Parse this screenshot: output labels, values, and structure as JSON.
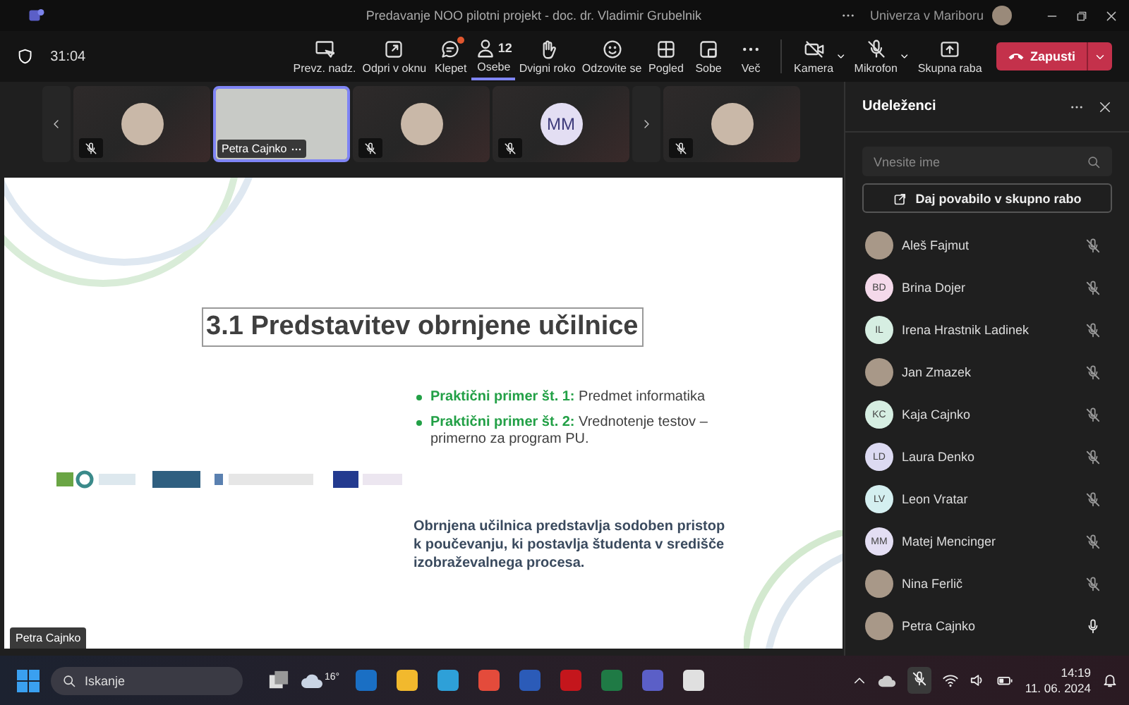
{
  "window": {
    "title": "Predavanje NOO pilotni projekt - doc. dr. Vladimir Grubelnik",
    "account": "Univerza v Mariboru"
  },
  "meeting": {
    "timer": "31:04"
  },
  "toolbar": {
    "items": [
      {
        "label": "Prevz. nadz.",
        "selected": false,
        "unread": false
      },
      {
        "label": "Odpri v oknu",
        "selected": false,
        "unread": false
      },
      {
        "label": "Klepet",
        "selected": false,
        "unread": true
      },
      {
        "label": "Osebe",
        "count": "12",
        "selected": true,
        "unread": false
      },
      {
        "label": "Dvigni roko",
        "selected": false,
        "unread": false
      },
      {
        "label": "Odzovite se",
        "selected": false,
        "unread": false
      },
      {
        "label": "Pogled",
        "selected": false,
        "unread": false
      },
      {
        "label": "Sobe",
        "selected": false,
        "unread": false
      },
      {
        "label": "Več",
        "selected": false,
        "unread": false
      }
    ],
    "devices": [
      {
        "kind": "camera",
        "label": "Kamera",
        "off": true
      },
      {
        "kind": "microphone",
        "label": "Mikrofon",
        "off": true
      },
      {
        "kind": "share",
        "label": "Skupna raba",
        "off": false
      }
    ],
    "leave": {
      "label": "Zapusti"
    }
  },
  "video_strip": [
    {
      "kind": "prev"
    },
    {
      "kind": "photo",
      "muted": true,
      "selected": false
    },
    {
      "kind": "video",
      "name": "Petra Cajnko",
      "muted": false,
      "selected": true
    },
    {
      "kind": "photo",
      "muted": true,
      "selected": false
    },
    {
      "kind": "initials",
      "initials": "MM",
      "muted": true,
      "selected": false
    },
    {
      "kind": "next"
    },
    {
      "kind": "photo",
      "muted": true,
      "selected": false
    }
  ],
  "slide": {
    "title": "3.1 Predstavitev obrnjene učilnice",
    "bullets": [
      "**Praktični primer št. 1:** Predmet informatika",
      "**Praktični primer št. 2:** Vrednotenje testov – primerno za program PU."
    ],
    "paragraph": "Obrnjena učilnica predstavlja sodoben pristop k poučevanju, ki postavlja študenta v središče izobraževalnega procesa.",
    "presenter": "Petra Cajnko"
  },
  "participants_panel": {
    "title": "Udeleženci",
    "search": {
      "placeholder": "Vnesite ime"
    },
    "invite_button": "Daj povabilo v skupno rabo",
    "participants": [
      {
        "name": "Aleš Fajmut",
        "kind": "photo",
        "muted": true
      },
      {
        "name": "Brina Dojer",
        "kind": "initials",
        "initials": "BD",
        "color": "#f4d9ea",
        "muted": true
      },
      {
        "name": "Irena Hrastnik Ladinek",
        "kind": "initials",
        "initials": "IL",
        "color": "#d6eee2",
        "muted": true
      },
      {
        "name": "Jan Zmazek",
        "kind": "photo",
        "muted": true
      },
      {
        "name": "Kaja Cajnko",
        "kind": "initials",
        "initials": "KC",
        "color": "#d6eee2",
        "muted": true
      },
      {
        "name": "Laura Denko",
        "kind": "initials",
        "initials": "LD",
        "color": "#dcdaf2",
        "muted": true
      },
      {
        "name": "Leon Vratar",
        "kind": "initials",
        "initials": "LV",
        "color": "#d4eff0",
        "muted": true
      },
      {
        "name": "Matej Mencinger",
        "kind": "initials",
        "initials": "MM",
        "color": "#e3def3",
        "muted": true
      },
      {
        "name": "Nina Ferlič",
        "kind": "photo",
        "muted": true
      },
      {
        "name": "Petra Cajnko",
        "kind": "photo",
        "muted": false
      }
    ]
  },
  "taskbar": {
    "search": {
      "placeholder": "Iskanje"
    },
    "weather": "16°",
    "time": "14:19",
    "date": "11. 06. 2024"
  }
}
